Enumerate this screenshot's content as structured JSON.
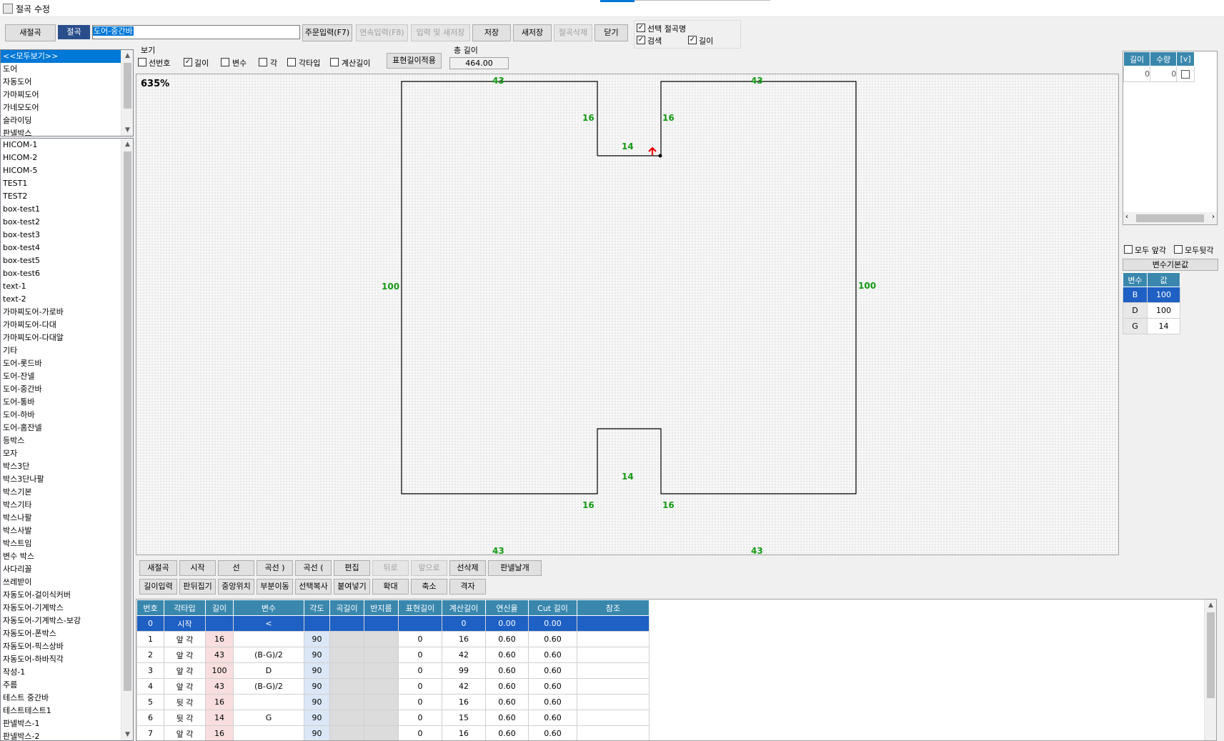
{
  "window": {
    "title": "절곡 수정"
  },
  "toolbar": {
    "new_bend": "새절곡",
    "bend_label": "절곡",
    "name_value": "도어-중간바",
    "order_input": "주문입력(F7)",
    "continuous_input": "연속입력(F8)",
    "input_save_as": "입력 및 새저장",
    "save": "저장",
    "save_new": "새저장",
    "delete_bend": "절곡삭제",
    "close": "닫기",
    "chk_selected_name": "선택 절곡명",
    "chk_search": "검색",
    "chk_length": "길이"
  },
  "view": {
    "label": "보기",
    "chk_line_no": "선번호",
    "chk_length": "길이",
    "chk_variable": "변수",
    "chk_angle": "각",
    "chk_angle_type": "각타입",
    "chk_calc_length": "계산길이",
    "apply_surface": "표현길이적용",
    "total_length_label": "총 길이",
    "total_length_value": "464.00"
  },
  "category_list": [
    "<<모두보기>>",
    "도어",
    "자동도어",
    "가마찌도어",
    "가네모도어",
    "슬라이딩",
    "판넬박스"
  ],
  "item_list": [
    "HICOM-1",
    "HICOM-2",
    "HICOM-5",
    "TEST1",
    "TEST2",
    "box-test1",
    "box-test2",
    "box-test3",
    "box-test4",
    "box-test5",
    "box-test6",
    "text-1",
    "text-2",
    "가마찌도어-가로바",
    "가마찌도어-다대",
    "가마찌도어-다대알",
    "기타",
    "도어-롯드바",
    "도어-잔넬",
    "도어-중간바",
    "도어-통바",
    "도어-하바",
    "도어-홈잔넬",
    "등박스",
    "모자",
    "박스3단",
    "박스3단나팔",
    "박스기본",
    "박스기타",
    "박스나팔",
    "박스사발",
    "박스트임",
    "변수 박스",
    "사다리꼴",
    "쓰레받이",
    "자동도어-걸이식커버",
    "자동도어-기계박스",
    "자동도어-기계박스-보강",
    "자동도어-폰박스",
    "자동도어-픽스상바",
    "자동도어-하바직각",
    "작성-1",
    "주름",
    "테스트 중간바",
    "테스트테스트1",
    "판넬박스-1",
    "판넬박스-2"
  ],
  "canvas": {
    "zoom": "635%",
    "dims": {
      "top_left": "43",
      "top_right": "43",
      "notch_left": "16",
      "notch_right": "16",
      "notch_top": "14",
      "left": "100",
      "right": "100",
      "bottom_notch_top": "14",
      "bottom_notch_left": "16",
      "bottom_notch_right": "16",
      "bottom_left": "43",
      "bottom_right": "43"
    }
  },
  "right_panel": {
    "headers": [
      "길이",
      "수량",
      "[v]"
    ],
    "row": [
      "0",
      "0"
    ],
    "chk_all_front": "모두 앞각",
    "chk_all_back": "모두뒷각",
    "var_default_btn": "변수기본값",
    "var_headers": [
      "변수",
      "값"
    ],
    "vars": [
      [
        "B",
        "100"
      ],
      [
        "D",
        "100"
      ],
      [
        "G",
        "14"
      ]
    ]
  },
  "bottom_toolbar": {
    "row1": [
      "새절곡",
      "시작",
      "선",
      "곡선 )",
      "곡선 (",
      "편집",
      "뒤로",
      "앞으로",
      "선삭제",
      "판넬날개"
    ],
    "row2": [
      "길이입력",
      "판뒤집기",
      "중앙위치",
      "부분이동",
      "선택복사",
      "붙여넣기",
      "확대",
      "축소",
      "격자"
    ]
  },
  "grid": {
    "headers": [
      "번호",
      "각타입",
      "길이",
      "변수",
      "각도",
      "곡길이",
      "반지름",
      "표현길이",
      "계산길이",
      "연신율",
      "Cut 길이",
      "참조"
    ],
    "rows": [
      [
        "0",
        "시작",
        "",
        "<",
        "",
        "",
        "",
        "",
        "0",
        "0.00",
        "0.00",
        ""
      ],
      [
        "1",
        "앞 각",
        "16",
        "",
        "90",
        "",
        "",
        "0",
        "16",
        "0.60",
        "0.60",
        ""
      ],
      [
        "2",
        "앞 각",
        "43",
        "(B-G)/2",
        "90",
        "",
        "",
        "0",
        "42",
        "0.60",
        "0.60",
        ""
      ],
      [
        "3",
        "앞 각",
        "100",
        "D",
        "90",
        "",
        "",
        "0",
        "99",
        "0.60",
        "0.60",
        ""
      ],
      [
        "4",
        "앞 각",
        "43",
        "(B-G)/2",
        "90",
        "",
        "",
        "0",
        "42",
        "0.60",
        "0.60",
        ""
      ],
      [
        "5",
        "뒷 각",
        "16",
        "",
        "90",
        "",
        "",
        "0",
        "16",
        "0.60",
        "0.60",
        ""
      ],
      [
        "6",
        "뒷 각",
        "14",
        "G",
        "90",
        "",
        "",
        "0",
        "15",
        "0.60",
        "0.60",
        ""
      ],
      [
        "7",
        "앞 각",
        "16",
        "",
        "90",
        "",
        "",
        "0",
        "16",
        "0.60",
        "0.60",
        ""
      ]
    ]
  }
}
